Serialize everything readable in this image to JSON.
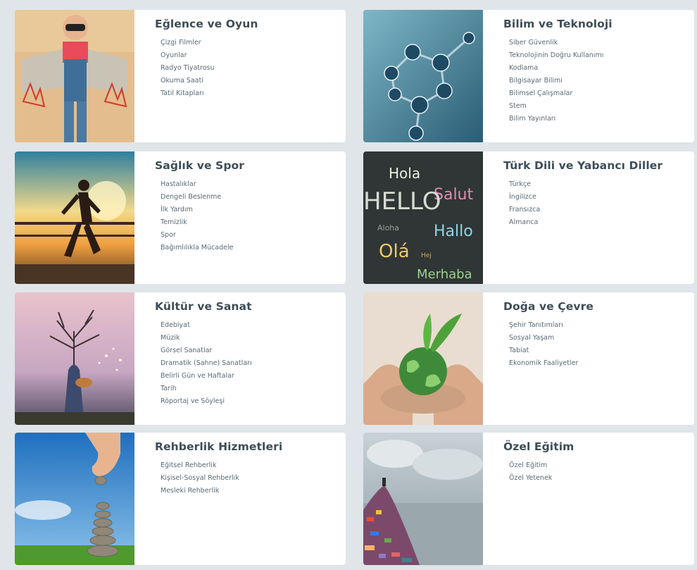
{
  "categories": [
    {
      "title": "Eğlence ve Oyun",
      "image": "child-with-cardboard-rocket-wings-photo",
      "items": [
        "Çizgi Filmler",
        "Oyunlar",
        "Radyo Tiyatrosu",
        "Okuma Saati",
        "Tatil Kitapları"
      ]
    },
    {
      "title": "Bilim ve Teknoloji",
      "image": "molecule-structure-photo",
      "items": [
        "Siber Güvenlik",
        "Teknolojinin Doğru Kullanımı",
        "Kodlama",
        "Bilgisayar Bilimi",
        "Bilimsel Çalışmalar",
        "Stem",
        "Bilim Yayınları"
      ]
    },
    {
      "title": "Sağlık ve Spor",
      "image": "runner-at-sunset-photo",
      "items": [
        "Hastalıklar",
        "Dengeli Beslenme",
        "İlk Yardım",
        "Temizlik",
        "Spor",
        "Bağımlılıkla Mücadele"
      ]
    },
    {
      "title": "Türk Dili ve Yabancı Diller",
      "image": "hello-words-chalkboard-photo",
      "items": [
        "Türkçe",
        "İngilizce",
        "Fransızca",
        "Almanca"
      ],
      "image_words": [
        "Hola",
        "Salut",
        "Hallo",
        "Olá",
        "Merhaba",
        "HELLO",
        "Aloha",
        "Hej"
      ]
    },
    {
      "title": "Kültür ve Sanat",
      "image": "tree-woman-with-guitar-art",
      "items": [
        "Edebiyat",
        "Müzik",
        "Görsel Sanatlar",
        "Dramatik (Sahne) Sanatları",
        "Belirli Gün ve Haftalar",
        "Tarih",
        "Röportaj ve Söyleşi"
      ]
    },
    {
      "title": "Doğa ve Çevre",
      "image": "hands-holding-globe-photo",
      "items": [
        "Şehir Tanıtımları",
        "Sosyal Yaşam",
        "Tabiat",
        "Ekonomik Faaliyetler"
      ]
    },
    {
      "title": "Rehberlik Hizmetleri",
      "image": "hand-stacking-stones-photo",
      "items": [
        "Eğitsel Rehberlik",
        "Kişisel-Sosyal Rehberlik",
        "Mesleki Rehberlik"
      ]
    },
    {
      "title": "Özel Eğitim",
      "image": "person-atop-colorful-letters-hill-photo",
      "items": [
        "Özel Eğitim",
        "Özel Yetenek"
      ]
    }
  ],
  "colors": {
    "background": "#dfe5e8",
    "card": "#ffffff",
    "title": "#3d4d57",
    "item": "#5a6a73"
  }
}
